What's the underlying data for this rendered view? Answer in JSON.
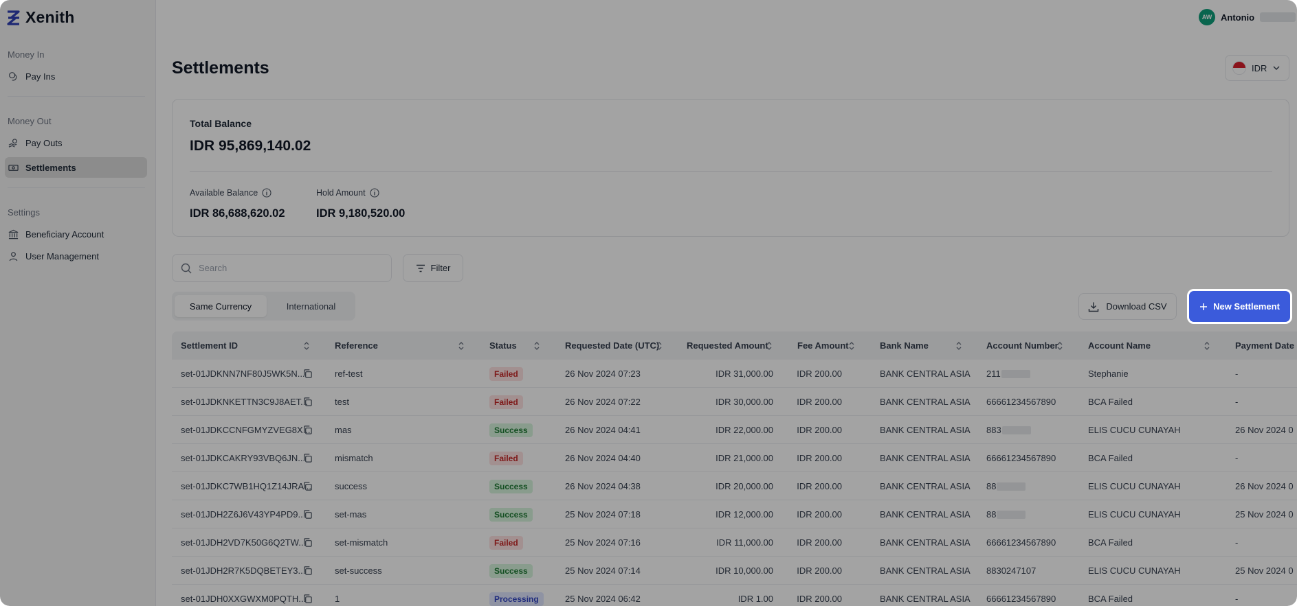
{
  "app": {
    "name": "Xenith"
  },
  "user": {
    "initials": "AW",
    "name": "Antonio"
  },
  "sidebar": {
    "sections": [
      {
        "title": "Money In",
        "items": [
          {
            "label": "Pay Ins",
            "icon": "coins-icon"
          }
        ]
      },
      {
        "title": "Money Out",
        "items": [
          {
            "label": "Pay Outs",
            "icon": "hand-coins-icon"
          },
          {
            "label": "Settlements",
            "icon": "banknote-icon",
            "active": true
          }
        ]
      },
      {
        "title": "Settings",
        "items": [
          {
            "label": "Beneficiary Account",
            "icon": "bank-icon"
          },
          {
            "label": "User Management",
            "icon": "user-icon"
          }
        ]
      }
    ]
  },
  "page": {
    "title": "Settlements"
  },
  "currency": {
    "selected": "IDR"
  },
  "balance": {
    "total_label": "Total Balance",
    "total_value": "IDR 95,869,140.02",
    "available_label": "Available Balance",
    "available_value": "IDR 86,688,620.02",
    "hold_label": "Hold Amount",
    "hold_value": "IDR 9,180,520.00"
  },
  "search": {
    "placeholder": "Search"
  },
  "filter": {
    "label": "Filter"
  },
  "tabs": [
    {
      "label": "Same Currency",
      "active": true
    },
    {
      "label": "International",
      "active": false
    }
  ],
  "actions": {
    "download_csv": "Download CSV",
    "new_settlement": "New Settlement"
  },
  "colors": {
    "primary": "#3b5bdb",
    "failed": "#c62828",
    "success": "#1e7a34",
    "processing": "#3346c4"
  },
  "table": {
    "columns": [
      "Settlement ID",
      "Reference",
      "Status",
      "Requested Date (UTC)",
      "Requested Amount",
      "Fee Amount",
      "Bank Name",
      "Account Number",
      "Account Name",
      "Payment Date"
    ],
    "rows": [
      {
        "id": "set-01JDKNN7NF80J5WK5N...",
        "reference": "ref-test",
        "status": "Failed",
        "date": "26 Nov 2024 07:23",
        "amount": "IDR 31,000.00",
        "fee": "IDR 200.00",
        "bank": "BANK CENTRAL ASIA",
        "account_number": "211",
        "account_redacted": true,
        "account_name": "Stephanie",
        "payment_date": "-"
      },
      {
        "id": "set-01JDKNKETTN3C9J8AET...",
        "reference": "test",
        "status": "Failed",
        "date": "26 Nov 2024 07:22",
        "amount": "IDR 30,000.00",
        "fee": "IDR 200.00",
        "bank": "BANK CENTRAL ASIA",
        "account_number": "66661234567890",
        "account_redacted": false,
        "account_name": "BCA Failed",
        "payment_date": "-"
      },
      {
        "id": "set-01JDKCCNFGMYZVEG8X...",
        "reference": "mas",
        "status": "Success",
        "date": "26 Nov 2024 04:41",
        "amount": "IDR 22,000.00",
        "fee": "IDR 200.00",
        "bank": "BANK CENTRAL ASIA",
        "account_number": "883",
        "account_redacted": true,
        "account_name": "ELIS CUCU CUNAYAH",
        "payment_date": "26 Nov 2024 0"
      },
      {
        "id": "set-01JDKCAKRY93VBQ6JN...",
        "reference": "mismatch",
        "status": "Failed",
        "date": "26 Nov 2024 04:40",
        "amount": "IDR 21,000.00",
        "fee": "IDR 200.00",
        "bank": "BANK CENTRAL ASIA",
        "account_number": "66661234567890",
        "account_redacted": false,
        "account_name": "BCA Failed",
        "payment_date": "-"
      },
      {
        "id": "set-01JDKC7WB1HQ1Z14JRA...",
        "reference": "success",
        "status": "Success",
        "date": "26 Nov 2024 04:38",
        "amount": "IDR 20,000.00",
        "fee": "IDR 200.00",
        "bank": "BANK CENTRAL ASIA",
        "account_number": "88",
        "account_redacted": true,
        "account_name": "ELIS CUCU CUNAYAH",
        "payment_date": "26 Nov 2024 0"
      },
      {
        "id": "set-01JDH2Z6J6V43YP4PD9...",
        "reference": "set-mas",
        "status": "Success",
        "date": "25 Nov 2024 07:18",
        "amount": "IDR 12,000.00",
        "fee": "IDR 200.00",
        "bank": "BANK CENTRAL ASIA",
        "account_number": "88",
        "account_redacted": true,
        "account_name": "ELIS CUCU CUNAYAH",
        "payment_date": "25 Nov 2024 0"
      },
      {
        "id": "set-01JDH2VD7K50G6Q2TW...",
        "reference": "set-mismatch",
        "status": "Failed",
        "date": "25 Nov 2024 07:16",
        "amount": "IDR 11,000.00",
        "fee": "IDR 200.00",
        "bank": "BANK CENTRAL ASIA",
        "account_number": "66661234567890",
        "account_redacted": false,
        "account_name": "BCA Failed",
        "payment_date": "-"
      },
      {
        "id": "set-01JDH2R7K5DQBETEY3...",
        "reference": "set-success",
        "status": "Success",
        "date": "25 Nov 2024 07:14",
        "amount": "IDR 10,000.00",
        "fee": "IDR 200.00",
        "bank": "BANK CENTRAL ASIA",
        "account_number": "8830247107",
        "account_redacted": false,
        "account_name": "ELIS CUCU CUNAYAH",
        "payment_date": "25 Nov 2024 0"
      },
      {
        "id": "set-01JDH0XXGWXM0PQTH...",
        "reference": "1",
        "status": "Processing",
        "date": "25 Nov 2024 06:42",
        "amount": "IDR 1.00",
        "fee": "IDR 200.00",
        "bank": "BANK CENTRAL ASIA",
        "account_number": "66661234567890",
        "account_redacted": false,
        "account_name": "BCA Failed",
        "payment_date": "-"
      }
    ]
  }
}
